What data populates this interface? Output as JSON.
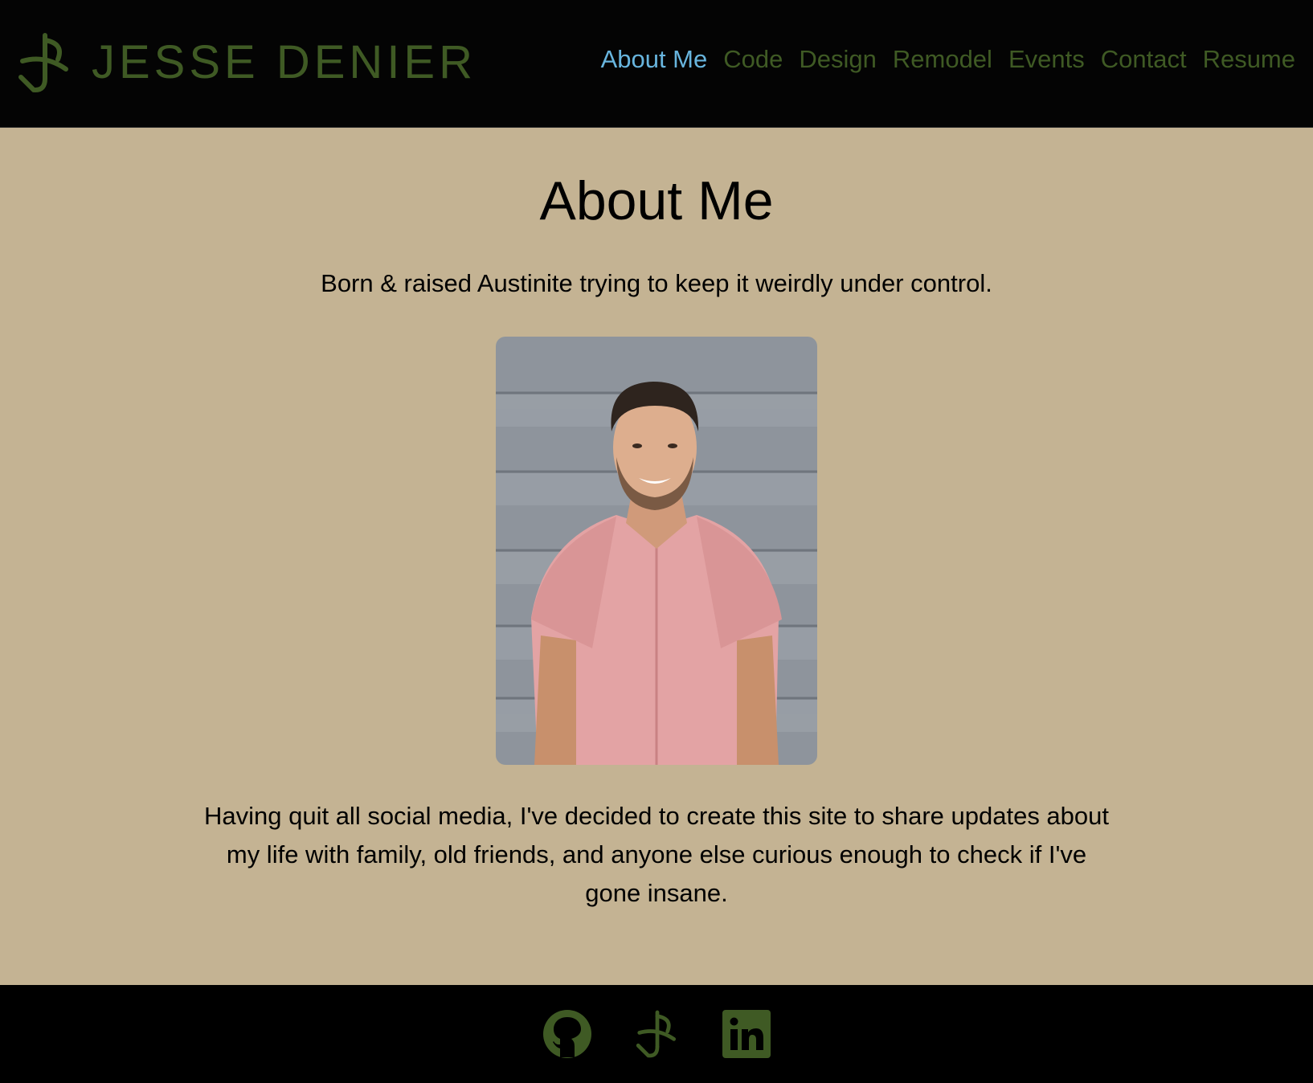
{
  "brand": {
    "name": "JESSE DENIER",
    "icon": "jd-monogram-icon",
    "color": "#3f5a24"
  },
  "nav": {
    "items": [
      {
        "label": "About Me",
        "active": true
      },
      {
        "label": "Code",
        "active": false
      },
      {
        "label": "Design",
        "active": false
      },
      {
        "label": "Remodel",
        "active": false
      },
      {
        "label": "Events",
        "active": false
      },
      {
        "label": "Contact",
        "active": false
      },
      {
        "label": "Resume",
        "active": false
      }
    ],
    "active_color": "#68b5de"
  },
  "main": {
    "title": "About Me",
    "tagline": "Born & raised Austinite trying to keep it weirdly under control.",
    "photo_icon": "portrait-photo",
    "bio": "Having quit all social media, I've decided to create this site to share updates about my life with family, old friends, and anyone else curious enough to check if I've gone insane.",
    "background": "#c4b393"
  },
  "footer": {
    "icons": [
      "github-icon",
      "jd-monogram-icon",
      "linkedin-icon"
    ]
  }
}
